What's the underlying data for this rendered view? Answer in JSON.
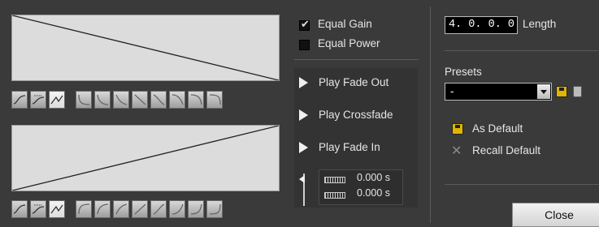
{
  "options": {
    "equal_gain_label": "Equal Gain",
    "equal_gain_checked": true,
    "equal_power_label": "Equal Power",
    "equal_power_checked": false
  },
  "playback": {
    "fade_out_label": "Play Fade Out",
    "crossfade_label": "Play Crossfade",
    "fade_in_label": "Play Fade In",
    "time_1": "0.000 s",
    "time_2": "0.000 s"
  },
  "length": {
    "value": "4. 0. 0.  0",
    "label": "Length"
  },
  "presets": {
    "label": "Presets",
    "selected": "-"
  },
  "defaults": {
    "as_default_label": "As Default",
    "recall_default_label": "Recall Default"
  },
  "close_label": "Close",
  "colors": {
    "panel_bg": "#3a3a3a",
    "curve_bg": "#dcdcdc",
    "text": "#e6e6e6"
  }
}
